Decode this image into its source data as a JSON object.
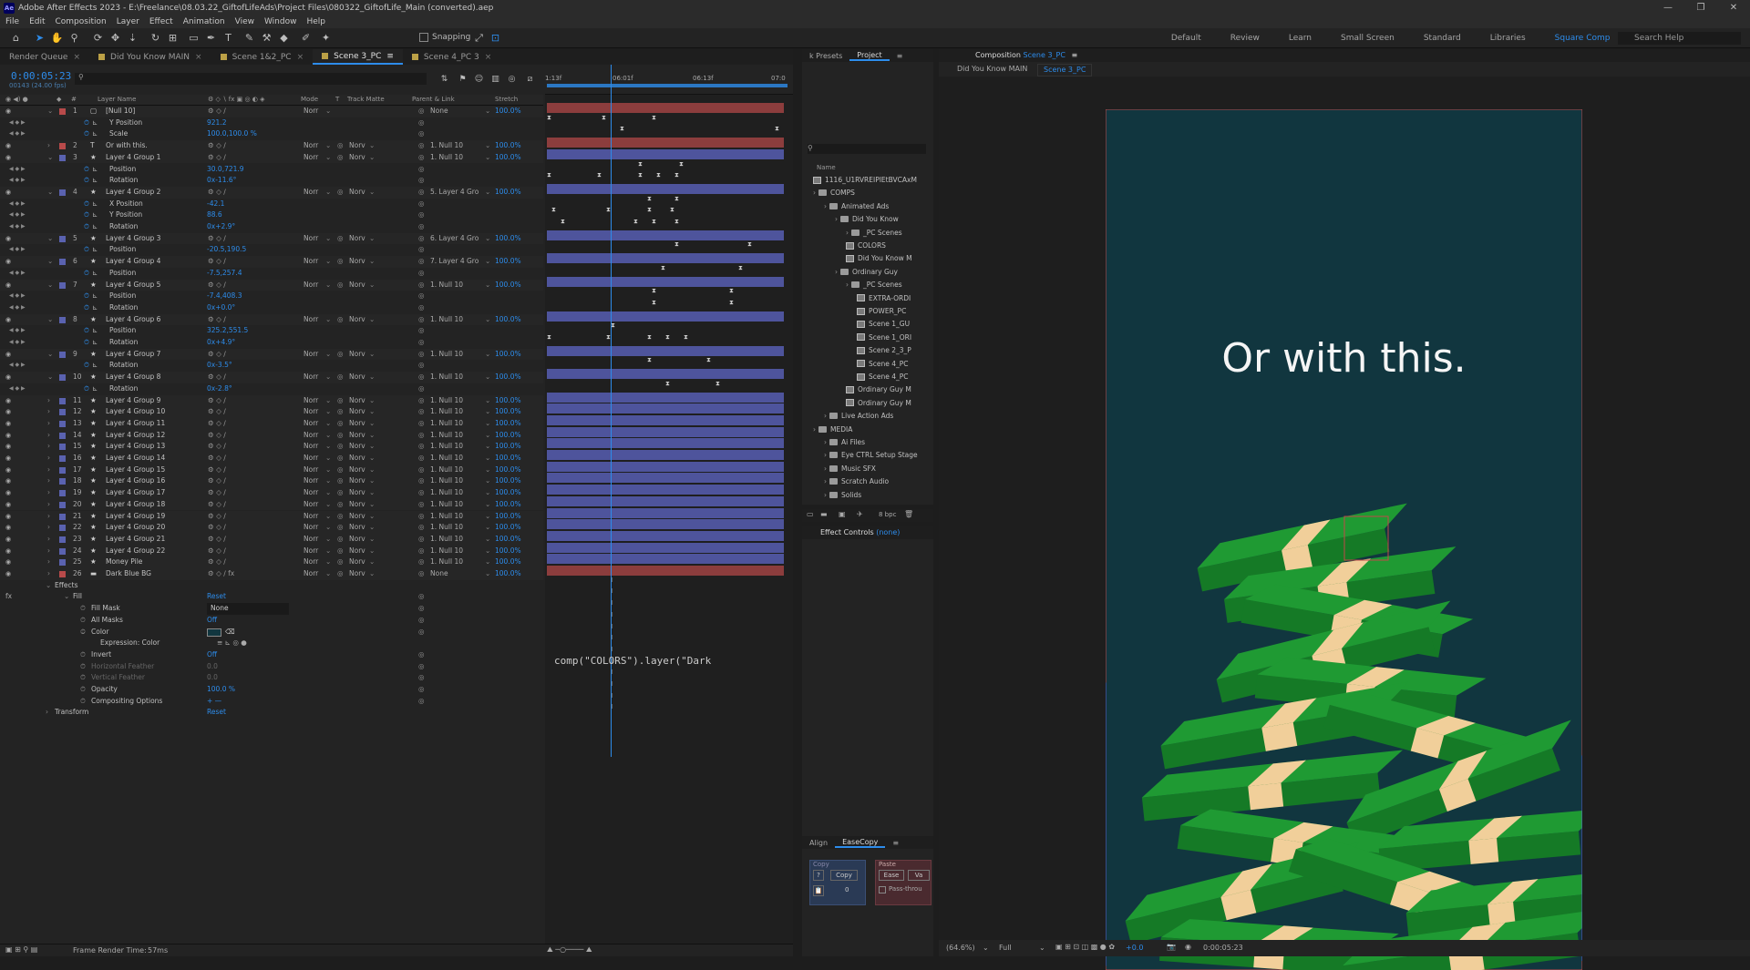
{
  "window": {
    "title": "Adobe After Effects 2023 - E:\\Freelance\\08.03.22_GiftofLifeAds\\Project Files\\080322_GiftofLife_Main (converted).aep",
    "app_icon": "Ae"
  },
  "menu": [
    "File",
    "Edit",
    "Composition",
    "Layer",
    "Effect",
    "Animation",
    "View",
    "Window",
    "Help"
  ],
  "toolbar": {
    "snapping_label": "Snapping",
    "workspaces": [
      "Default",
      "Review",
      "Learn",
      "Small Screen",
      "Standard",
      "Libraries",
      "Square Comp"
    ],
    "active_workspace": "Square Comp",
    "help_search": "Search Help"
  },
  "timeline": {
    "tabs": [
      {
        "label": "Render Queue",
        "active": false,
        "icon": false
      },
      {
        "label": "Did You Know MAIN",
        "active": false,
        "icon": true
      },
      {
        "label": "Scene 1&2_PC",
        "active": false,
        "icon": true
      },
      {
        "label": "Scene 3_PC",
        "active": true,
        "icon": true
      },
      {
        "label": "Scene 4_PC 3",
        "active": false,
        "icon": true
      }
    ],
    "timecode": "0:00:05:23",
    "fps": "00143 (24.00 fps)",
    "columns": {
      "layer_name": "Layer Name",
      "mode": "Mode",
      "t": "T",
      "track_matte": "Track Matte",
      "parent_link": "Parent & Link",
      "stretch": "Stretch"
    },
    "ruler": {
      "start": "1:13f",
      "mid": "06:01f",
      "mid2": "06:13f",
      "end": "07:0"
    },
    "expression_text": "comp(\"COLORS\").layer(\"Dark",
    "frame_render_time_label": "Frame Render Time:",
    "frame_render_time": "57ms",
    "rows": [
      {
        "kind": "layer",
        "num": "1",
        "color": "#b84a4a",
        "name": "[Null 10]",
        "mode": "Norr",
        "trk": "",
        "par": "None",
        "str": "100.0%",
        "bar": "#8c3d3d",
        "icon": "null"
      },
      {
        "kind": "prop",
        "name": "Y Position",
        "val": "921.2",
        "kfs": [
          0,
          60,
          115
        ]
      },
      {
        "kind": "prop",
        "name": "Scale",
        "val": "100.0,100.0 %",
        "kfs": [
          80,
          250
        ]
      },
      {
        "kind": "layer",
        "num": "2",
        "color": "#b84a4a",
        "name": "Or with this.",
        "mode": "Norr",
        "trk": "Norv",
        "par": "1. Null 10",
        "str": "100.0%",
        "bar": "#8c3d3d",
        "icon": "text"
      },
      {
        "kind": "layer",
        "num": "3",
        "color": "#5a62b0",
        "name": "Layer 4 Group 1",
        "mode": "Norr",
        "trk": "Norv",
        "par": "1. Null 10",
        "str": "100.0%",
        "bar": "#4e549c",
        "icon": "star"
      },
      {
        "kind": "prop",
        "name": "Position",
        "val": "30.0,721.9",
        "kfs": [
          100,
          145
        ]
      },
      {
        "kind": "prop",
        "name": "Rotation",
        "val": "0x-11.6°",
        "kfs": [
          0,
          55,
          100,
          120,
          140
        ]
      },
      {
        "kind": "layer",
        "num": "4",
        "color": "#5a62b0",
        "name": "Layer 4 Group 2",
        "mode": "Norr",
        "trk": "Norv",
        "par": "5. Layer 4 Gro",
        "str": "100.0%",
        "bar": "#4e549c",
        "icon": "star"
      },
      {
        "kind": "prop",
        "name": "X Position",
        "val": "-42.1",
        "kfs": [
          110,
          140
        ]
      },
      {
        "kind": "prop",
        "name": "Y Position",
        "val": "88.6",
        "kfs": [
          5,
          65,
          110,
          135
        ]
      },
      {
        "kind": "prop",
        "name": "Rotation",
        "val": "0x+2.9°",
        "kfs": [
          15,
          95,
          115,
          140
        ]
      },
      {
        "kind": "layer",
        "num": "5",
        "color": "#5a62b0",
        "name": "Layer 4 Group 3",
        "mode": "Norr",
        "trk": "Norv",
        "par": "6. Layer 4 Gro",
        "str": "100.0%",
        "bar": "#4e549c",
        "icon": "star"
      },
      {
        "kind": "prop",
        "name": "Position",
        "val": "-20.5,190.5",
        "kfs": [
          140,
          220
        ]
      },
      {
        "kind": "layer",
        "num": "6",
        "color": "#5a62b0",
        "name": "Layer 4 Group 4",
        "mode": "Norr",
        "trk": "Norv",
        "par": "7. Layer 4 Gro",
        "str": "100.0%",
        "bar": "#4e549c",
        "icon": "star"
      },
      {
        "kind": "prop",
        "name": "Position",
        "val": "-7.5,257.4",
        "kfs": [
          125,
          210
        ]
      },
      {
        "kind": "layer",
        "num": "7",
        "color": "#5a62b0",
        "name": "Layer 4 Group 5",
        "mode": "Norr",
        "trk": "Norv",
        "par": "1. Null 10",
        "str": "100.0%",
        "bar": "#4e549c",
        "icon": "star"
      },
      {
        "kind": "prop",
        "name": "Position",
        "val": "-7.4,408.3",
        "kfs": [
          115,
          200
        ]
      },
      {
        "kind": "prop",
        "name": "Rotation",
        "val": "0x+0.0°",
        "kfs": [
          115,
          200
        ]
      },
      {
        "kind": "layer",
        "num": "8",
        "color": "#5a62b0",
        "name": "Layer 4 Group 6",
        "mode": "Norr",
        "trk": "Norv",
        "par": "1. Null 10",
        "str": "100.0%",
        "bar": "#4e549c",
        "icon": "star"
      },
      {
        "kind": "prop",
        "name": "Position",
        "val": "325.2,551.5",
        "kfs": [
          70
        ]
      },
      {
        "kind": "prop",
        "name": "Rotation",
        "val": "0x+4.9°",
        "kfs": [
          0,
          65,
          110,
          130,
          150
        ]
      },
      {
        "kind": "layer",
        "num": "9",
        "color": "#5a62b0",
        "name": "Layer 4 Group 7",
        "mode": "Norr",
        "trk": "Norv",
        "par": "1. Null 10",
        "str": "100.0%",
        "bar": "#4e549c",
        "icon": "star"
      },
      {
        "kind": "prop",
        "name": "Rotation",
        "val": "0x-3.5°",
        "kfs": [
          110,
          175
        ]
      },
      {
        "kind": "layer",
        "num": "10",
        "color": "#5a62b0",
        "name": "Layer 4 Group 8",
        "mode": "Norr",
        "trk": "Norv",
        "par": "1. Null 10",
        "str": "100.0%",
        "bar": "#4e549c",
        "icon": "star"
      },
      {
        "kind": "prop",
        "name": "Rotation",
        "val": "0x-2.8°",
        "kfs": [
          130,
          185
        ]
      },
      {
        "kind": "layer",
        "num": "11",
        "color": "#5a62b0",
        "name": "Layer 4 Group 9",
        "mode": "Norr",
        "trk": "Norv",
        "par": "1. Null 10",
        "str": "100.0%",
        "bar": "#4e549c",
        "icon": "star"
      },
      {
        "kind": "layer",
        "num": "12",
        "color": "#5a62b0",
        "name": "Layer 4 Group 10",
        "mode": "Norr",
        "trk": "Norv",
        "par": "1. Null 10",
        "str": "100.0%",
        "bar": "#4e549c",
        "icon": "star"
      },
      {
        "kind": "layer",
        "num": "13",
        "color": "#5a62b0",
        "name": "Layer 4 Group 11",
        "mode": "Norr",
        "trk": "Norv",
        "par": "1. Null 10",
        "str": "100.0%",
        "bar": "#4e549c",
        "icon": "star"
      },
      {
        "kind": "layer",
        "num": "14",
        "color": "#5a62b0",
        "name": "Layer 4 Group 12",
        "mode": "Norr",
        "trk": "Norv",
        "par": "1. Null 10",
        "str": "100.0%",
        "bar": "#4e549c",
        "icon": "star"
      },
      {
        "kind": "layer",
        "num": "15",
        "color": "#5a62b0",
        "name": "Layer 4 Group 13",
        "mode": "Norr",
        "trk": "Norv",
        "par": "1. Null 10",
        "str": "100.0%",
        "bar": "#4e549c",
        "icon": "star"
      },
      {
        "kind": "layer",
        "num": "16",
        "color": "#5a62b0",
        "name": "Layer 4 Group 14",
        "mode": "Norr",
        "trk": "Norv",
        "par": "1. Null 10",
        "str": "100.0%",
        "bar": "#4e549c",
        "icon": "star"
      },
      {
        "kind": "layer",
        "num": "17",
        "color": "#5a62b0",
        "name": "Layer 4 Group 15",
        "mode": "Norr",
        "trk": "Norv",
        "par": "1. Null 10",
        "str": "100.0%",
        "bar": "#4e549c",
        "icon": "star"
      },
      {
        "kind": "layer",
        "num": "18",
        "color": "#5a62b0",
        "name": "Layer 4 Group 16",
        "mode": "Norr",
        "trk": "Norv",
        "par": "1. Null 10",
        "str": "100.0%",
        "bar": "#4e549c",
        "icon": "star"
      },
      {
        "kind": "layer",
        "num": "19",
        "color": "#5a62b0",
        "name": "Layer 4 Group 17",
        "mode": "Norr",
        "trk": "Norv",
        "par": "1. Null 10",
        "str": "100.0%",
        "bar": "#4e549c",
        "icon": "star"
      },
      {
        "kind": "layer",
        "num": "20",
        "color": "#5a62b0",
        "name": "Layer 4 Group 18",
        "mode": "Norr",
        "trk": "Norv",
        "par": "1. Null 10",
        "str": "100.0%",
        "bar": "#4e549c",
        "icon": "star"
      },
      {
        "kind": "layer",
        "num": "21",
        "color": "#5a62b0",
        "name": "Layer 4 Group 19",
        "mode": "Norr",
        "trk": "Norv",
        "par": "1. Null 10",
        "str": "100.0%",
        "bar": "#4e549c",
        "icon": "star"
      },
      {
        "kind": "layer",
        "num": "22",
        "color": "#5a62b0",
        "name": "Layer 4 Group 20",
        "mode": "Norr",
        "trk": "Norv",
        "par": "1. Null 10",
        "str": "100.0%",
        "bar": "#4e549c",
        "icon": "star"
      },
      {
        "kind": "layer",
        "num": "23",
        "color": "#5a62b0",
        "name": "Layer 4 Group 21",
        "mode": "Norr",
        "trk": "Norv",
        "par": "1. Null 10",
        "str": "100.0%",
        "bar": "#4e549c",
        "icon": "star"
      },
      {
        "kind": "layer",
        "num": "24",
        "color": "#5a62b0",
        "name": "Layer 4 Group 22",
        "mode": "Norr",
        "trk": "Norv",
        "par": "1. Null 10",
        "str": "100.0%",
        "bar": "#4e549c",
        "icon": "star"
      },
      {
        "kind": "layer",
        "num": "25",
        "color": "#5a62b0",
        "name": "Money Pile",
        "mode": "Norr",
        "trk": "Norv",
        "par": "1. Null 10",
        "str": "100.0%",
        "bar": "#4e549c",
        "icon": "star"
      },
      {
        "kind": "layer",
        "num": "26",
        "color": "#b84a4a",
        "name": "Dark Blue BG",
        "mode": "Norr",
        "trk": "Norv",
        "par": "None",
        "str": "100.0%",
        "bar": "#8c3d3d",
        "icon": "solid"
      },
      {
        "kind": "group",
        "name": "Effects",
        "val": ""
      },
      {
        "kind": "group2",
        "name": "Fill",
        "val": "Reset"
      },
      {
        "kind": "sub",
        "name": "Fill Mask",
        "val": "None"
      },
      {
        "kind": "sub",
        "name": "All Masks",
        "val": "Off"
      },
      {
        "kind": "sub",
        "name": "Color",
        "val": ""
      },
      {
        "kind": "sub2",
        "name": "Expression: Color",
        "val": ""
      },
      {
        "kind": "sub",
        "name": "Invert",
        "val": "Off"
      },
      {
        "kind": "subdim",
        "name": "Horizontal Feather",
        "val": "0.0"
      },
      {
        "kind": "subdim",
        "name": "Vertical Feather",
        "val": "0.0"
      },
      {
        "kind": "sub",
        "name": "Opacity",
        "val": "100.0 %"
      },
      {
        "kind": "sub",
        "name": "Compositing Options",
        "val": "+ —"
      },
      {
        "kind": "group",
        "name": "Transform",
        "val": "Reset"
      }
    ]
  },
  "project": {
    "tabs": [
      "k Presets",
      "Project"
    ],
    "active_tab": "Project",
    "name_col": "Name",
    "bpc": "8 bpc",
    "items": [
      {
        "depth": 0,
        "type": "comp",
        "label": "1116_U1RVREIPIEtBVCAxM"
      },
      {
        "depth": 0,
        "type": "folder",
        "label": "COMPS"
      },
      {
        "depth": 1,
        "type": "folder",
        "label": "Animated Ads"
      },
      {
        "depth": 2,
        "type": "folder",
        "label": "Did You Know"
      },
      {
        "depth": 3,
        "type": "folder",
        "label": "_PC Scenes"
      },
      {
        "depth": 3,
        "type": "comp",
        "label": "COLORS"
      },
      {
        "depth": 3,
        "type": "comp",
        "label": "Did You Know M"
      },
      {
        "depth": 2,
        "type": "folder",
        "label": "Ordinary Guy"
      },
      {
        "depth": 3,
        "type": "folder",
        "label": "_PC Scenes"
      },
      {
        "depth": 4,
        "type": "comp",
        "label": "EXTRA-ORDI"
      },
      {
        "depth": 4,
        "type": "comp",
        "label": "POWER_PC"
      },
      {
        "depth": 4,
        "type": "comp",
        "label": "Scene 1_GU"
      },
      {
        "depth": 4,
        "type": "comp",
        "label": "Scene 1_ORI"
      },
      {
        "depth": 4,
        "type": "comp",
        "label": "Scene 2_3_P"
      },
      {
        "depth": 4,
        "type": "comp",
        "label": "Scene 4_PC"
      },
      {
        "depth": 4,
        "type": "comp",
        "label": "Scene 4_PC"
      },
      {
        "depth": 3,
        "type": "comp",
        "label": "Ordinary Guy M"
      },
      {
        "depth": 3,
        "type": "comp",
        "label": "Ordinary Guy M"
      },
      {
        "depth": 1,
        "type": "folder",
        "label": "Live Action Ads"
      },
      {
        "depth": 0,
        "type": "folder",
        "label": "MEDIA"
      },
      {
        "depth": 1,
        "type": "folder",
        "label": "Ai Files"
      },
      {
        "depth": 1,
        "type": "folder",
        "label": "Eye CTRL Setup Stage"
      },
      {
        "depth": 1,
        "type": "folder",
        "label": "Music SFX"
      },
      {
        "depth": 1,
        "type": "folder",
        "label": "Scratch Audio"
      },
      {
        "depth": 1,
        "type": "folder",
        "label": "Solids"
      }
    ]
  },
  "effect_controls": {
    "label": "Effect Controls",
    "target": "(none)"
  },
  "align_panel": {
    "tabs": [
      "Align",
      "EaseCopy"
    ],
    "active_tab": "EaseCopy",
    "copy_group": "Copy",
    "paste_group": "Paste",
    "question": "?",
    "copy_btn": "Copy",
    "zero": "0",
    "ease_btn": "Ease",
    "va_btn": "Va",
    "pass_through": "Pass-throu"
  },
  "composition": {
    "panel_label": "Composition",
    "comp_name": "Scene 3_PC",
    "breadcrumb": [
      "Did You Know MAIN",
      "Scene 3_PC"
    ],
    "headline": "Or with this.",
    "bg_color": "#11363f",
    "money_green": "#1f9a33",
    "money_dark": "#157a26",
    "money_band": "#f1cf9a",
    "zoom": "(64.6%)",
    "resolution": "Full",
    "exposure": "+0.0",
    "timecode": "0:00:05:23"
  },
  "colors": {
    "accent": "#2d8ceb",
    "label_red": "#b84a4a",
    "label_blue": "#5a62b0"
  }
}
